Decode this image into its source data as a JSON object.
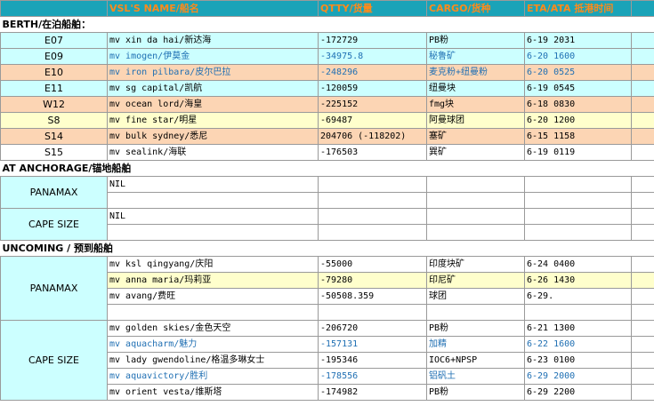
{
  "headers": {
    "vessel": "VSL'S NAME/船名",
    "qtty": "QTTY/货量",
    "cargo": "CARGO/货种",
    "eta": "ETA/ATA 抵港时间"
  },
  "sections": {
    "berth": "BERTH/在泊船舶：",
    "anchorage": "AT ANCHORAGE/锚地船舶",
    "upcoming": "UNCOMING / 预到船舶"
  },
  "berth_rows": [
    {
      "berth": "E07",
      "vessel": "mv xin da hai/新达海",
      "qtty": "-172729",
      "cargo": "PB粉",
      "eta": "6-19 2031"
    },
    {
      "berth": "E09",
      "vessel": "mv imogen/伊莫金",
      "qtty": "-34975.8",
      "cargo": "秘鲁矿",
      "eta": "6-20 1600"
    },
    {
      "berth": "E10",
      "vessel": "mv iron pilbara/皮尔巴拉",
      "qtty": "-248296",
      "cargo": "麦克粉+纽曼粉",
      "eta": "6-20 0525"
    },
    {
      "berth": "E11",
      "vessel": "mv sg capital/凯航",
      "qtty": "-120059",
      "cargo": "纽曼块",
      "eta": "6-19 0545"
    },
    {
      "berth": "W12",
      "vessel": "mv ocean lord/海皇",
      "qtty": "-225152",
      "cargo": "fmg块",
      "eta": "6-18 0830"
    },
    {
      "berth": "S8",
      "vessel": "mv fine star/明星",
      "qtty": "-69487",
      "cargo": "阿曼球团",
      "eta": "6-20 1200"
    },
    {
      "berth": "S14",
      "vessel": "mv bulk sydney/悉尼",
      "qtty": "204706 (-118202)",
      "cargo": "塞矿",
      "eta": "6-15 1158"
    },
    {
      "berth": "S15",
      "vessel": "mv sealink/海联",
      "qtty": "-176503",
      "cargo": "巽矿",
      "eta": "6-19 0119"
    }
  ],
  "anchorage": {
    "panamax_label": "PANAMAX",
    "panamax_value": "NIL",
    "cape_label": "CAPE SIZE",
    "cape_value": "NIL"
  },
  "upcoming": {
    "panamax_label": "PANAMAX",
    "cape_label": "CAPE SIZE",
    "panamax_rows": [
      {
        "vessel": "mv ksl qingyang/庆阳",
        "qtty": "-55000",
        "cargo": "印度块矿",
        "eta": "6-24 0400"
      },
      {
        "vessel": "mv anna maria/玛莉亚",
        "qtty": "-79280",
        "cargo": "印尼矿",
        "eta": "6-26 1430"
      },
      {
        "vessel": "mv avang/费旺",
        "qtty": "-50508.359",
        "cargo": "球团",
        "eta": "6-29."
      }
    ],
    "cape_rows": [
      {
        "vessel": "mv golden skies/金色天空",
        "qtty": "-206720",
        "cargo": "PB粉",
        "eta": "6-21 1300"
      },
      {
        "vessel": "mv aquacharm/魅力",
        "qtty": "-157131",
        "cargo": "加精",
        "eta": "6-22 1600"
      },
      {
        "vessel": "mv lady gwendoline/格温多琳女士",
        "qtty": "-195346",
        "cargo": "IOC6+NPSP",
        "eta": "6-23 0100"
      },
      {
        "vessel": "mv aquavictory/胜利",
        "qtty": "-178556",
        "cargo": "铝矾土",
        "eta": "6-29 2000"
      },
      {
        "vessel": "mv orient vesta/维斯塔",
        "qtty": "-174982",
        "cargo": "PB粉",
        "eta": "6-29 2200"
      }
    ]
  }
}
